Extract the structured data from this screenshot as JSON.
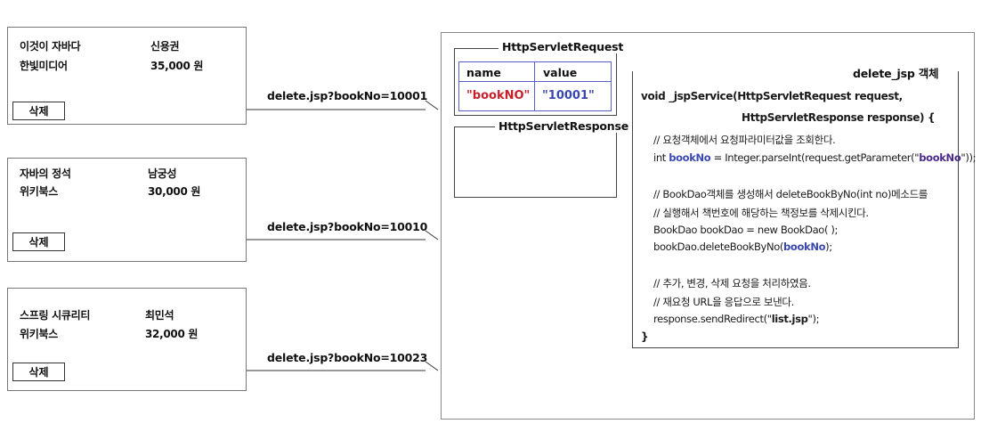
{
  "books": [
    {
      "title": "이것이 자바다",
      "author": "신용권",
      "publisher": "한빛미디어",
      "price": "35,000 원",
      "delete_label": "삭제",
      "url": "delete.jsp?bookNo=10001"
    },
    {
      "title": "자바의 정석",
      "author": "남궁성",
      "publisher": "위키북스",
      "price": "30,000 원",
      "delete_label": "삭제",
      "url": "delete.jsp?bookNo=10010"
    },
    {
      "title": "스프링 시큐리티",
      "author": "최민석",
      "publisher": "위키북스",
      "price": "32,000 원",
      "delete_label": "삭제",
      "url": "delete.jsp?bookNo=10023"
    }
  ],
  "request": {
    "title": "HttpServletRequest",
    "col_name": "name",
    "col_value": "value",
    "param_name": "\"bookNO\"",
    "param_value": "\"10001\""
  },
  "response": {
    "title": "HttpServletResponse"
  },
  "jsp": {
    "title": "delete_jsp 객체",
    "sig1": "void _jspService(HttpServletRequest request,",
    "sig2": "HttpServletResponse response) {",
    "c1": "// 요청객체에서 요청파라미터값을 조회한다.",
    "c2_pre": "int ",
    "c2_var": "bookNo",
    "c2_mid": " = Integer.parseInt(request.getParameter(\"",
    "c2_str": "bookNo",
    "c2_end": "\"));",
    "c3": "// BookDao객체를 생성해서 deleteBookByNo(int no)메소드를",
    "c4": "// 실행해서 책번호에 해당하는 책정보를 삭제시킨다.",
    "c5": "BookDao bookDao = new BookDao( );",
    "c6_pre": "bookDao.deleteBookByNo(",
    "c6_var": "bookNo",
    "c6_end": ");",
    "c7": "// 추가, 변경, 삭제 요청을 처리하였음.",
    "c8": "// 재요청 URL을 응답으로 보낸다.",
    "c9_pre": "response.sendRedirect(\"",
    "c9_str": "list.jsp",
    "c9_end": "\");",
    "close": "}"
  },
  "colors": {
    "param_name": "#c8202a",
    "param_value": "#3a48b0",
    "table_border": "#5860c8"
  }
}
